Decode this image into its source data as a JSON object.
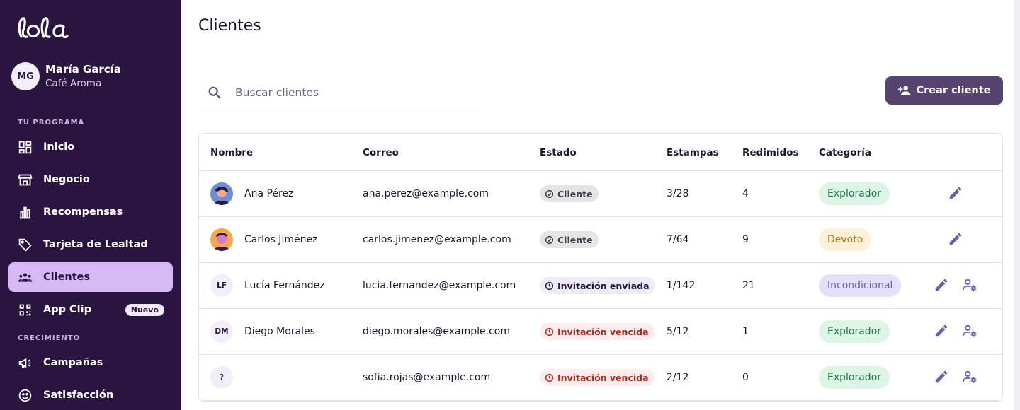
{
  "brand": {
    "logo_text": "lola"
  },
  "user": {
    "initials": "MG",
    "name": "María García",
    "business": "Café Aroma"
  },
  "sidebar": {
    "section_program": "TU PROGRAMA",
    "section_growth": "CRECIMIENTO",
    "items": [
      {
        "label": "Inicio",
        "icon": "dashboard-icon"
      },
      {
        "label": "Negocio",
        "icon": "store-icon"
      },
      {
        "label": "Recompensas",
        "icon": "bar-chart-icon"
      },
      {
        "label": "Tarjeta de Lealtad",
        "icon": "tag-icon"
      },
      {
        "label": "Clientes",
        "icon": "group-icon",
        "active": true
      },
      {
        "label": "App Clip",
        "icon": "qr-code-icon",
        "badge": "Nuevo"
      },
      {
        "label": "Campañas",
        "icon": "megaphone-icon"
      },
      {
        "label": "Satisfacción",
        "icon": "smiley-icon"
      }
    ]
  },
  "page": {
    "title": "Clientes"
  },
  "search": {
    "placeholder": "Buscar clientes"
  },
  "actions": {
    "create_label": "Crear cliente"
  },
  "table": {
    "headers": [
      "Nombre",
      "Correo",
      "Estado",
      "Estampas",
      "Redimidos",
      "Categoría"
    ],
    "rows": [
      {
        "avatar": "photo",
        "initials": "",
        "name": "Ana Pérez",
        "email": "ana.perez@example.com",
        "status": "Cliente",
        "status_type": "cliente",
        "stamps": "3/28",
        "redeemed": "4",
        "category": "Explorador",
        "category_type": "explorador",
        "has_manage": false
      },
      {
        "avatar": "photo",
        "initials": "",
        "name": "Carlos Jiménez",
        "email": "carlos.jimenez@example.com",
        "status": "Cliente",
        "status_type": "cliente",
        "stamps": "7/64",
        "redeemed": "9",
        "category": "Devoto",
        "category_type": "devoto",
        "has_manage": false
      },
      {
        "avatar": "initials",
        "initials": "LF",
        "name": "Lucía Fernández",
        "email": "lucia.fernandez@example.com",
        "status": "Invitación enviada",
        "status_type": "enviada",
        "stamps": "1/142",
        "redeemed": "21",
        "category": "Incondicional",
        "category_type": "incondicional",
        "has_manage": true
      },
      {
        "avatar": "initials",
        "initials": "DM",
        "name": "Diego Morales",
        "email": "diego.morales@example.com",
        "status": "Invitación vencida",
        "status_type": "vencida",
        "stamps": "5/12",
        "redeemed": "1",
        "category": "Explorador",
        "category_type": "explorador",
        "has_manage": true
      },
      {
        "avatar": "initials",
        "initials": "?",
        "name": "",
        "email": "sofia.rojas@example.com",
        "status": "Invitación vencida",
        "status_type": "vencida",
        "stamps": "2/12",
        "redeemed": "0",
        "category": "Explorador",
        "category_type": "explorador",
        "has_manage": true
      }
    ]
  },
  "colors": {
    "sidebar_bg": "#2a1540",
    "accent": "#564370",
    "active_nav": "#d6b8f5",
    "icon_purple": "#6a5fb5"
  }
}
